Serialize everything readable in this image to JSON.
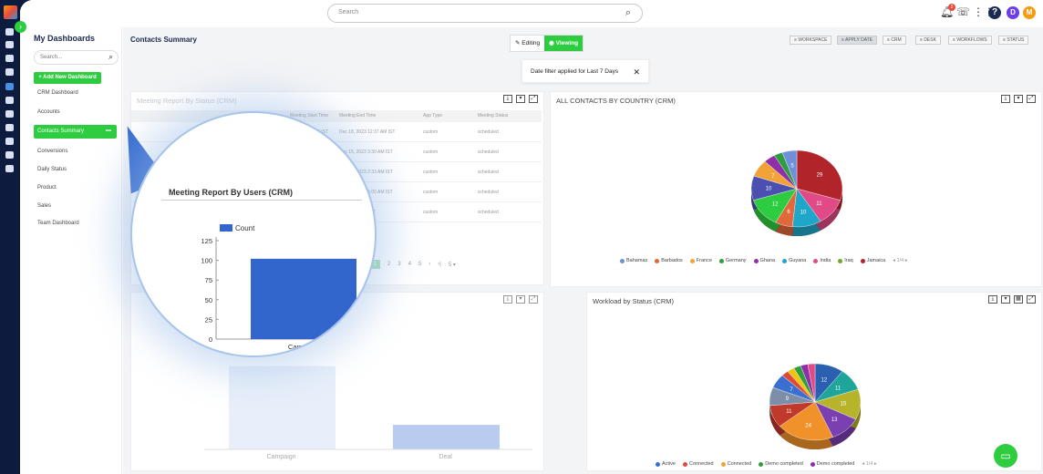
{
  "topbar": {
    "search_placeholder": "Search",
    "notification_count": "2",
    "avatars": [
      {
        "letter": "D",
        "color": "#6c3ee8"
      },
      {
        "letter": "M",
        "color": "#f39c12"
      }
    ]
  },
  "sidebar": {
    "title": "My Dashboards",
    "search_placeholder": "Search...",
    "add_label": "+ Add New Dashboard",
    "items": [
      {
        "label": "CRM Dashboard"
      },
      {
        "label": "Accounts"
      },
      {
        "label": "Contacts Summary"
      },
      {
        "label": "Conversions"
      },
      {
        "label": "Daily Status"
      },
      {
        "label": "Product"
      },
      {
        "label": "Sales"
      },
      {
        "label": "Team Dashboard"
      }
    ],
    "active_more": "•••"
  },
  "header": {
    "title": "Contacts Summary",
    "editing_label": "Editing",
    "viewing_label": "Viewing",
    "filters": [
      "WORKSPACE",
      "APPLY DATE",
      "CRM",
      "DESK",
      "WORKFLOWS",
      "STATUS"
    ],
    "toast": "Date filter applied for Last 7 Days"
  },
  "meeting_report": {
    "title": "Meeting Report By Status   (CRM)",
    "columns": [
      "Meeting Start Time",
      "Meeting End Time",
      "App Type",
      "Meeting Status"
    ],
    "rows": [
      [
        "AM IST",
        "Dec 18, 2023 12:37 AM IST",
        "custom",
        "scheduled"
      ],
      [
        "",
        "Dec 15, 2023 3:30 AM IST",
        "custom",
        "scheduled"
      ],
      [
        "",
        "Dec 14, 2023 2:33 AM IST",
        "custom",
        "scheduled"
      ],
      [
        "",
        "Dec 14, 2023 6:00 AM IST",
        "custom",
        "scheduled"
      ],
      [
        "",
        "2023 8:30 AM IST",
        "custom",
        "scheduled"
      ]
    ],
    "pages": [
      "1",
      "2",
      "3",
      "4",
      "5"
    ],
    "page_size": "5"
  },
  "country_chart": {
    "title": "ALL CONTACTS BY COUNTRY   (CRM)",
    "legend": [
      {
        "label": "Bahamas",
        "color": "#6f8fd8"
      },
      {
        "label": "Barbados",
        "color": "#e0683a"
      },
      {
        "label": "France",
        "color": "#f1a33a"
      },
      {
        "label": "Germany",
        "color": "#2d9d3e"
      },
      {
        "label": "Ghana",
        "color": "#8e2fa8"
      },
      {
        "label": "Guyana",
        "color": "#1fa6c9"
      },
      {
        "label": "India",
        "color": "#e04a86"
      },
      {
        "label": "Iraq",
        "color": "#6fa82a"
      },
      {
        "label": "Jamaica",
        "color": "#b0242a"
      }
    ],
    "page": "1/4"
  },
  "workload_chart": {
    "title": "Workload by Status   (CRM)",
    "legend": [
      {
        "label": "Active",
        "color": "#3a6fd1"
      },
      {
        "label": "Connected",
        "color": "#e04a3a"
      },
      {
        "label": "Connected",
        "color": "#f1a33a"
      },
      {
        "label": "Demo completed",
        "color": "#2d9d3e"
      },
      {
        "label": "Demo completed",
        "color": "#8e2fa8"
      }
    ],
    "page": "1/4"
  },
  "users_chart": {
    "title": "Meeting Report By Users   (CRM)",
    "legend": "Count"
  },
  "chart_data": [
    {
      "type": "pie",
      "title": "ALL CONTACTS BY COUNTRY (CRM)",
      "slices": [
        {
          "label": "Jamaica",
          "value": 29,
          "color": "#b0242a"
        },
        {
          "label": "India",
          "value": 11,
          "color": "#e04a86"
        },
        {
          "label": "Guyana",
          "value": 10,
          "color": "#1fa6c9"
        },
        {
          "label": "Barbados",
          "value": 6,
          "color": "#e0683a"
        },
        {
          "label": "",
          "value": 12,
          "color": "#2ecc40"
        },
        {
          "label": "",
          "value": 10,
          "color": "#4a4fb0"
        },
        {
          "label": "France",
          "value": 7,
          "color": "#f1a33a"
        },
        {
          "label": "Ghana",
          "value": 4,
          "color": "#8e2fa8"
        },
        {
          "label": "Germany",
          "value": 3,
          "color": "#2d9d3e"
        },
        {
          "label": "Bahamas",
          "value": 5,
          "color": "#6f8fd8"
        }
      ]
    },
    {
      "type": "pie",
      "title": "Workload by Status (CRM)",
      "slices": [
        {
          "label": "",
          "value": 12,
          "color": "#2b5fb0"
        },
        {
          "label": "",
          "value": 11,
          "color": "#1fa69a"
        },
        {
          "label": "",
          "value": 15,
          "color": "#b7b32a"
        },
        {
          "label": "",
          "value": 13,
          "color": "#7a3fb0"
        },
        {
          "label": "",
          "value": 24,
          "color": "#f1912a"
        },
        {
          "label": "",
          "value": 11,
          "color": "#c0392b"
        },
        {
          "label": "",
          "value": 9,
          "color": "#7d8fa8"
        },
        {
          "label": "",
          "value": 7,
          "color": "#3a6fd1"
        },
        {
          "label": "",
          "value": 3,
          "color": "#e04a3a"
        },
        {
          "label": "",
          "value": 3,
          "color": "#f1c40f"
        },
        {
          "label": "",
          "value": 3,
          "color": "#2d9d3e"
        },
        {
          "label": "",
          "value": 3,
          "color": "#8e2fa8"
        },
        {
          "label": "",
          "value": 3,
          "color": "#e04a86"
        }
      ]
    },
    {
      "type": "bar",
      "title": "Meeting Report By Users (CRM)",
      "categories": [
        "Campaign",
        "Deal"
      ],
      "series": [
        {
          "name": "Count",
          "values": [
            102,
            30
          ]
        }
      ],
      "yticks": [
        "0",
        "25",
        "50",
        "75",
        "100",
        "125"
      ],
      "ylim": [
        0,
        125
      ]
    }
  ]
}
